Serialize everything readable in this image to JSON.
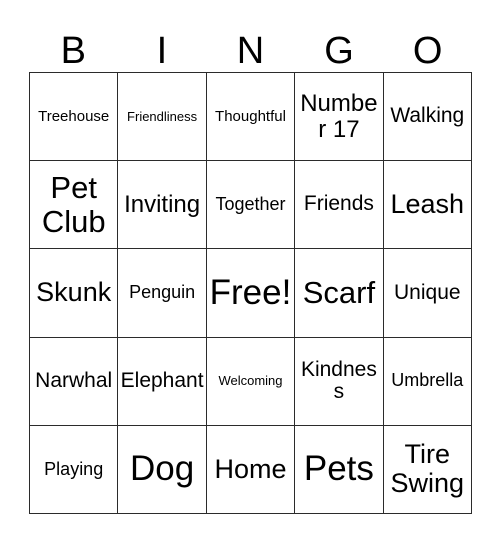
{
  "card": {
    "title": "BINGO",
    "header_letters": [
      "B",
      "I",
      "N",
      "G",
      "O"
    ],
    "free_space_label": "Free!",
    "colors": {
      "border": "#2b2b2b",
      "background": "#ffffff",
      "text": "#000000"
    },
    "grid": {
      "columns": 5,
      "rows": 5,
      "cells": [
        {
          "text": "Treehouse",
          "size": "s-sm",
          "free": false
        },
        {
          "text": "Friendliness",
          "size": "s-xs",
          "free": false
        },
        {
          "text": "Thoughtful",
          "size": "s-sm",
          "free": false
        },
        {
          "text": "Number 17",
          "size": "s-xl",
          "free": false
        },
        {
          "text": "Walking",
          "size": "s-lg",
          "free": false
        },
        {
          "text": "Pet Club",
          "size": "s-3xl",
          "free": false
        },
        {
          "text": "Inviting",
          "size": "s-xl",
          "free": false
        },
        {
          "text": "Together",
          "size": "s-md",
          "free": false
        },
        {
          "text": "Friends",
          "size": "s-lg",
          "free": false
        },
        {
          "text": "Leash",
          "size": "s-2xl",
          "free": false
        },
        {
          "text": "Skunk",
          "size": "s-2xl",
          "free": false
        },
        {
          "text": "Penguin",
          "size": "s-md",
          "free": false
        },
        {
          "text": "Free!",
          "size": "s-4xl",
          "free": true
        },
        {
          "text": "Scarf",
          "size": "s-3xl",
          "free": false
        },
        {
          "text": "Unique",
          "size": "s-lg",
          "free": false
        },
        {
          "text": "Narwhal",
          "size": "s-lg",
          "free": false
        },
        {
          "text": "Elephant",
          "size": "s-lg",
          "free": false
        },
        {
          "text": "Welcoming",
          "size": "s-xs",
          "free": false
        },
        {
          "text": "Kindness",
          "size": "s-lg",
          "free": false
        },
        {
          "text": "Umbrella",
          "size": "s-md",
          "free": false
        },
        {
          "text": "Playing",
          "size": "s-md",
          "free": false
        },
        {
          "text": "Dog",
          "size": "s-4xl",
          "free": false
        },
        {
          "text": "Home",
          "size": "s-2xl",
          "free": false
        },
        {
          "text": "Pets",
          "size": "s-4xl",
          "free": false
        },
        {
          "text": "Tire Swing",
          "size": "s-2xl",
          "free": false
        }
      ]
    }
  }
}
